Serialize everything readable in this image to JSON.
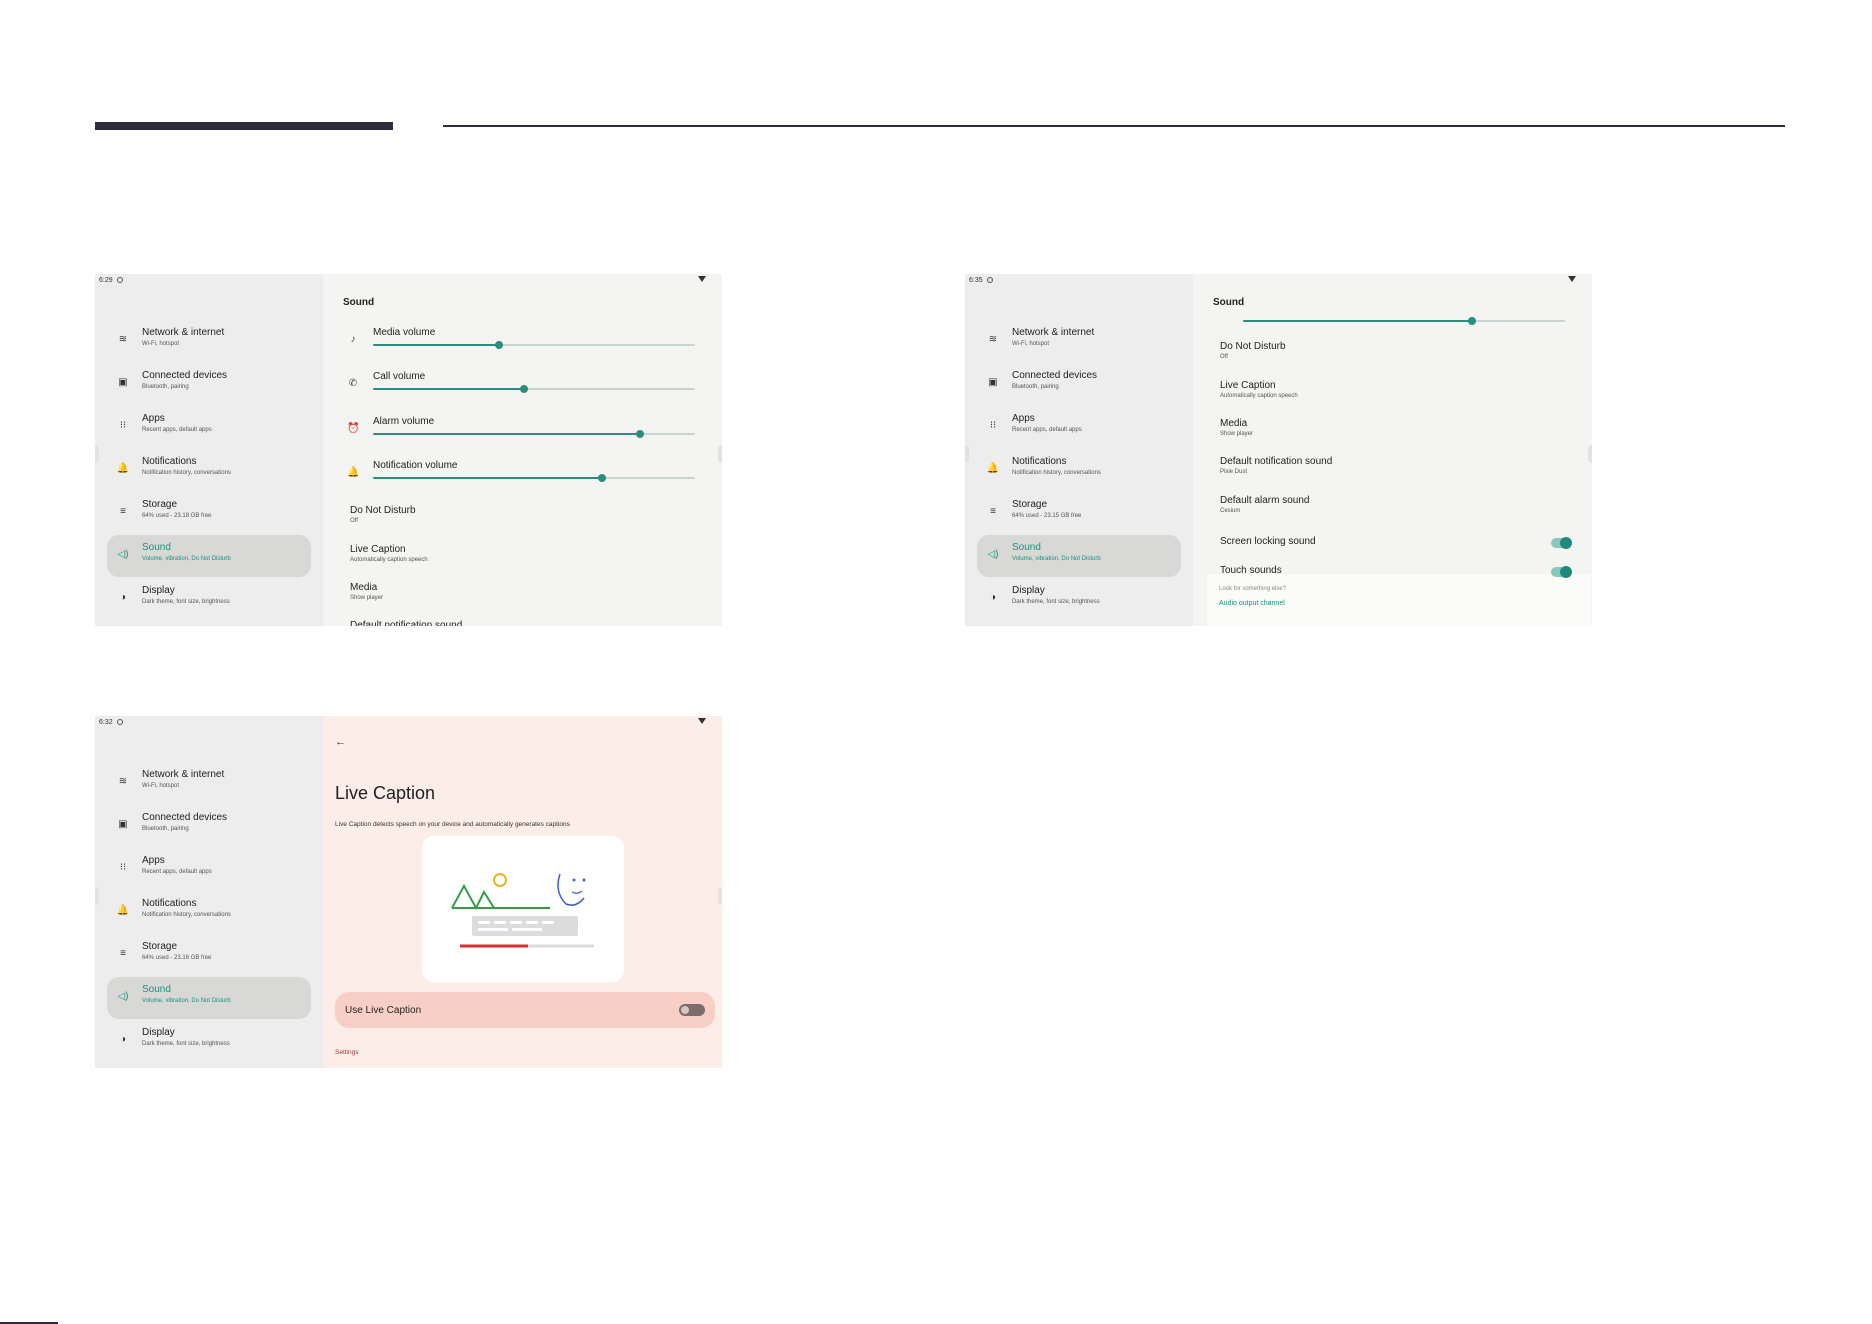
{
  "screens": [
    {
      "status": {
        "time": "6:29"
      },
      "nav": [
        {
          "title": "Network & internet",
          "sub": "Wi-Fi, hotspot",
          "icon": "wifi-icon",
          "glyph": "≋"
        },
        {
          "title": "Connected devices",
          "sub": "Bluetooth, pairing",
          "icon": "devices-icon",
          "glyph": "▣"
        },
        {
          "title": "Apps",
          "sub": "Recent apps, default apps",
          "icon": "apps-grid-icon",
          "glyph": "⁝⁝"
        },
        {
          "title": "Notifications",
          "sub": "Notification history, conversations",
          "icon": "bell-icon",
          "glyph": "🔔"
        },
        {
          "title": "Storage",
          "sub": "64% used - 23.18 GB free",
          "icon": "storage-icon",
          "glyph": "≡"
        },
        {
          "title": "Sound",
          "sub": "Volume, vibration, Do Not Disturb",
          "icon": "speaker-icon",
          "glyph": "◁)",
          "active": true
        },
        {
          "title": "Display",
          "sub": "Dark theme, font size, brightness",
          "icon": "display-icon",
          "glyph": "◑"
        }
      ],
      "title": "Sound",
      "volumes": [
        {
          "label": "Media volume",
          "icon": "music-note-icon",
          "glyph": "♪",
          "level": 0.39
        },
        {
          "label": "Call volume",
          "icon": "phone-icon",
          "glyph": "✆",
          "level": 0.47
        },
        {
          "label": "Alarm volume",
          "icon": "alarm-icon",
          "glyph": "⏰",
          "level": 0.83
        },
        {
          "label": "Notification volume",
          "icon": "bell-icon",
          "glyph": "🔔",
          "level": 0.71
        }
      ],
      "prefs": [
        {
          "title": "Do Not Disturb",
          "sub": "Off"
        },
        {
          "title": "Live Caption",
          "sub": "Automatically caption speech"
        },
        {
          "title": "Media",
          "sub": "Show player"
        },
        {
          "title": "Default notification sound",
          "sub": ""
        }
      ]
    },
    {
      "status": {
        "time": "6:35"
      },
      "nav": [
        {
          "title": "Network & internet",
          "sub": "Wi-Fi, hotspot",
          "icon": "wifi-icon",
          "glyph": "≋"
        },
        {
          "title": "Connected devices",
          "sub": "Bluetooth, pairing",
          "icon": "devices-icon",
          "glyph": "▣"
        },
        {
          "title": "Apps",
          "sub": "Recent apps, default apps",
          "icon": "apps-grid-icon",
          "glyph": "⁝⁝"
        },
        {
          "title": "Notifications",
          "sub": "Notification history, conversations",
          "icon": "bell-icon",
          "glyph": "🔔"
        },
        {
          "title": "Storage",
          "sub": "64% used - 23.15 GB free",
          "icon": "storage-icon",
          "glyph": "≡"
        },
        {
          "title": "Sound",
          "sub": "Volume, vibration, Do Not Disturb",
          "icon": "speaker-icon",
          "glyph": "◁)",
          "active": true
        },
        {
          "title": "Display",
          "sub": "Dark theme, font size, brightness",
          "icon": "display-icon",
          "glyph": "◑"
        }
      ],
      "title": "Sound",
      "top_slider_level": 0.71,
      "prefs": [
        {
          "title": "Do Not Disturb",
          "sub": "Off"
        },
        {
          "title": "Live Caption",
          "sub": "Automatically caption speech"
        },
        {
          "title": "Media",
          "sub": "Show player"
        },
        {
          "title": "Default notification sound",
          "sub": "Pixie Dust"
        },
        {
          "title": "Default alarm sound",
          "sub": "Cesium"
        }
      ],
      "toggles": [
        {
          "title": "Screen locking sound",
          "on": true
        },
        {
          "title": "Touch sounds",
          "on": true
        }
      ],
      "suggest": {
        "question": "Look for something else?",
        "link": "Audio output channel"
      }
    },
    {
      "status": {
        "time": "6:32"
      },
      "nav": [
        {
          "title": "Network & internet",
          "sub": "Wi-Fi, hotspot",
          "icon": "wifi-icon",
          "glyph": "≋"
        },
        {
          "title": "Connected devices",
          "sub": "Bluetooth, pairing",
          "icon": "devices-icon",
          "glyph": "▣"
        },
        {
          "title": "Apps",
          "sub": "Recent apps, default apps",
          "icon": "apps-grid-icon",
          "glyph": "⁝⁝"
        },
        {
          "title": "Notifications",
          "sub": "Notification history, conversations",
          "icon": "bell-icon",
          "glyph": "🔔"
        },
        {
          "title": "Storage",
          "sub": "64% used - 23.16 GB free",
          "icon": "storage-icon",
          "glyph": "≡"
        },
        {
          "title": "Sound",
          "sub": "Volume, vibration, Do Not Disturb",
          "icon": "speaker-icon",
          "glyph": "◁)",
          "active": true
        },
        {
          "title": "Display",
          "sub": "Dark theme, font size, brightness",
          "icon": "display-icon",
          "glyph": "◑"
        }
      ],
      "live_caption": {
        "title": "Live Caption",
        "description": "Live Caption detects speech on your device and automatically generates captions",
        "use_label": "Use Live Caption",
        "use_on": false,
        "settings_label": "Settings"
      }
    }
  ],
  "colors": {
    "accent": "#1a8f7f",
    "nav_bg": "#ecedec",
    "content_bg": "#f4f4f2",
    "live_caption_bg": "#fcede9",
    "use_row_bg": "#f8cfc6"
  }
}
